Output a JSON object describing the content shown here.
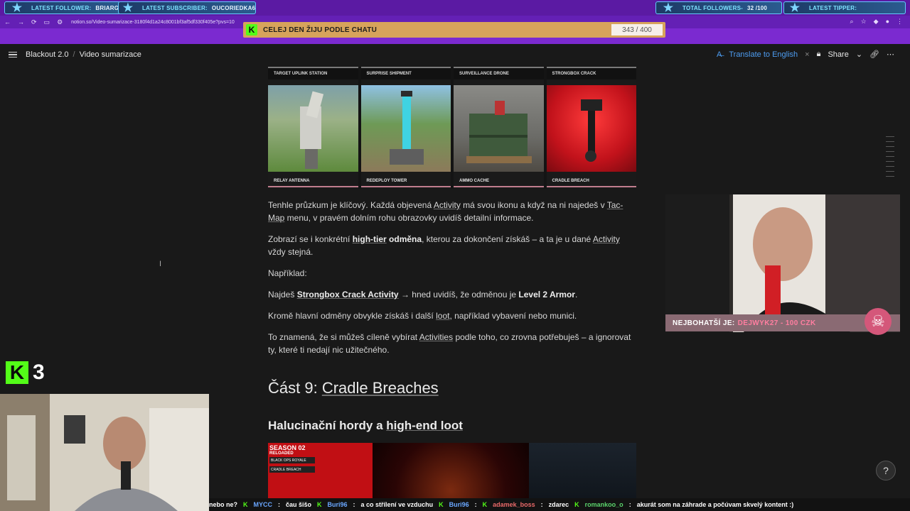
{
  "overlay": {
    "latest_follower_label": "LATEST FOLLOWER:",
    "latest_follower": "BriarGap",
    "latest_subscriber_label": "LATEST SUBSCRIBER:",
    "latest_subscriber": "Oucoriedka6",
    "total_followers_label": "TOTAL Followers-",
    "total_followers": "32 /100",
    "latest_tipper_label": "LATEST TIPPER:"
  },
  "browser": {
    "url": "notion.so/Video-sumarizace-3180f4d1a24c8001bf3af5df330f405e?pvs=10"
  },
  "goal": {
    "text": "CELEJ DEN ŽIJU PODLE CHATU",
    "count": "343 / 400"
  },
  "notion": {
    "breadcrumb": [
      "Blackout 2.0",
      "Video sumarizace"
    ],
    "translate": "Translate to English",
    "share": "Share"
  },
  "doc": {
    "tiles": [
      {
        "title": "TARGET UPLINK STATION",
        "caption": "RELAY ANTENNA"
      },
      {
        "title": "SURPRISE SHIPMENT",
        "caption": "REDEPLOY TOWER"
      },
      {
        "title": "SURVEILLANCE DRONE",
        "caption": "AMMO CACHE"
      },
      {
        "title": "STRONGBOX CRACK",
        "caption": "CRADLE BREACH"
      }
    ],
    "p1": {
      "a": "Tenhle průzkum je klíčový. Každá objevená ",
      "b": "Activity",
      "c": " má svou ikonu a když na ni najedeš v ",
      "d": "Tac-Map",
      "e": " menu, v pravém dolním rohu obrazovky uvidíš detailní informace."
    },
    "p2": {
      "a": "Zobrazí se i konkrétní ",
      "b": "high-tier",
      "c": " odměna",
      "d": ", kterou za dokončení získáš – a ta je u dané ",
      "e": "Activity",
      "f": " vždy stejná."
    },
    "p3": "Například:",
    "p4": {
      "a": "Najdeš ",
      "b": "Strongbox Crack Activity",
      "c": " → hned uvidíš, že odměnou je ",
      "d": "Level 2 Armor",
      "e": "."
    },
    "p5": {
      "a": "Kromě hlavní odměny obvykle získáš i další ",
      "b": "loot",
      "c": ", například vybavení nebo munici."
    },
    "p6": {
      "a": "To znamená, že si můžeš cíleně vybírat ",
      "b": "Activities",
      "c": " podle toho, co zrovna potřebuješ – a ignorovat ty, které ti nedají nic užitečného."
    },
    "h2": {
      "a": "Část 9: ",
      "b": "Cradle Breaches"
    },
    "h3": {
      "a": "Halucinační hordy a ",
      "b": "high-end loot"
    },
    "bottom_img": {
      "l1": "SEASON 02",
      "l2": "RELOADED",
      "l3": "BLACK OPS ROYALE",
      "l4": "CRADLE BREACH"
    }
  },
  "stream": {
    "richest_label": "NEJBOHATŠÍ JE:",
    "richest_value": "DEJWYK27 - 100 CZK",
    "kick_count": "3"
  },
  "ticker": [
    {
      "name": "",
      "msg": "nebo ne?"
    },
    {
      "name": "MYCC",
      "msg": "čau šišo"
    },
    {
      "name": "Buri96",
      "msg": "a co střílení ve vzduchu"
    },
    {
      "name": "Buri96",
      "msg": ""
    },
    {
      "name": "adamek_boss",
      "msg": "zdarec"
    },
    {
      "name": "romankoo_o",
      "msg": "akurát som na záhrade a počúvam skvelý kontent :)"
    }
  ],
  "colors": {
    "overlay_purple": "#5b1aa3",
    "kick_green": "#53fc18",
    "notion_bg": "#191919",
    "translate_blue": "#4d9cf0"
  }
}
